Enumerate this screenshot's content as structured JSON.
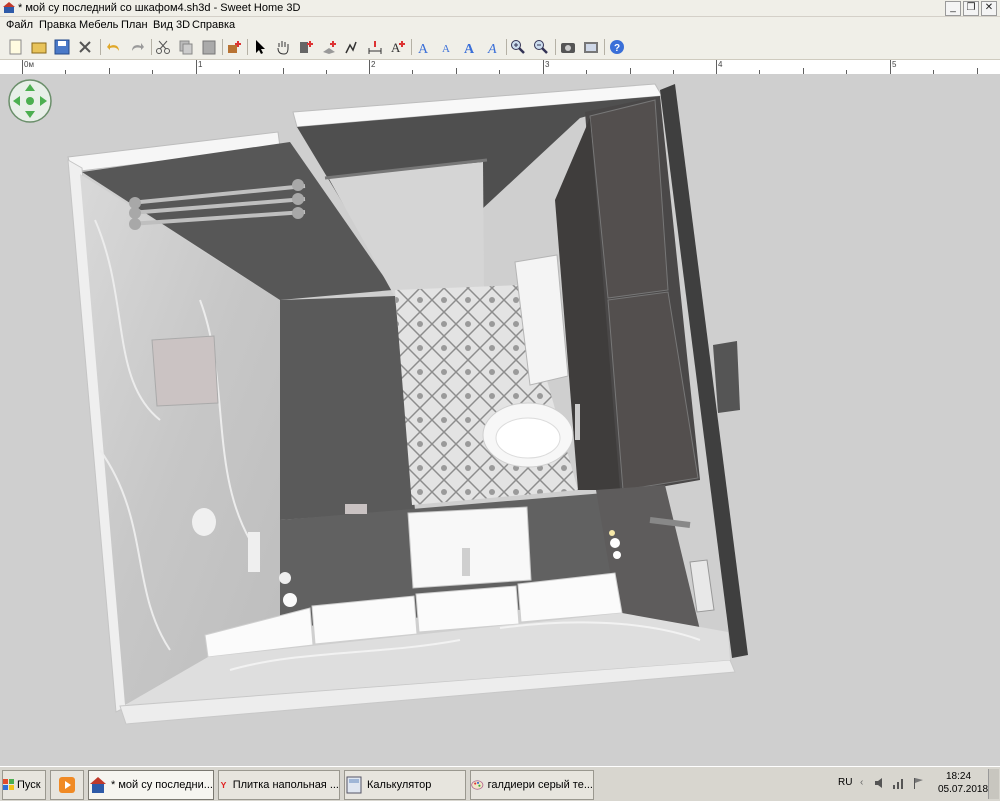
{
  "window": {
    "title": "* мой су последний со шкафом4.sh3d - Sweet Home 3D",
    "buttons": [
      "_",
      "❐",
      "✕"
    ]
  },
  "menu": [
    "Файл",
    "Правка",
    "Мебель",
    "План",
    "Вид 3D",
    "Справка"
  ],
  "toolbar": {
    "icons": [
      "new-file",
      "open-file",
      "save-file",
      "cut-preferences",
      "undo",
      "redo",
      "cut",
      "copy",
      "paste",
      "add-furniture",
      "select",
      "pan",
      "create-walls",
      "create-rooms",
      "create-polylines",
      "create-dimensions",
      "create-labels",
      "increase-text",
      "decrease-text",
      "bold-text",
      "italic-text",
      "zoom-in",
      "zoom-out",
      "create-photo",
      "create-video",
      "help"
    ]
  },
  "ruler": {
    "labels": [
      "0м",
      "1",
      "2",
      "3",
      "4",
      "5"
    ]
  },
  "taskbar": {
    "start_label": "Пуск",
    "tasks": [
      {
        "label": "* мой су последни...",
        "icon": "sweethome-icon"
      },
      {
        "label": "Плитка напольная ...",
        "icon": "yandex-icon"
      },
      {
        "label": "Калькулятор",
        "icon": "calculator-icon"
      },
      {
        "label": "галдиери серый те...",
        "icon": "paint-icon"
      }
    ],
    "lang": "RU",
    "time": "18:24",
    "date": "05.07.2018"
  },
  "colors": {
    "accent": "#3a6fd8",
    "viewport_bg": "#cfcfcf"
  }
}
